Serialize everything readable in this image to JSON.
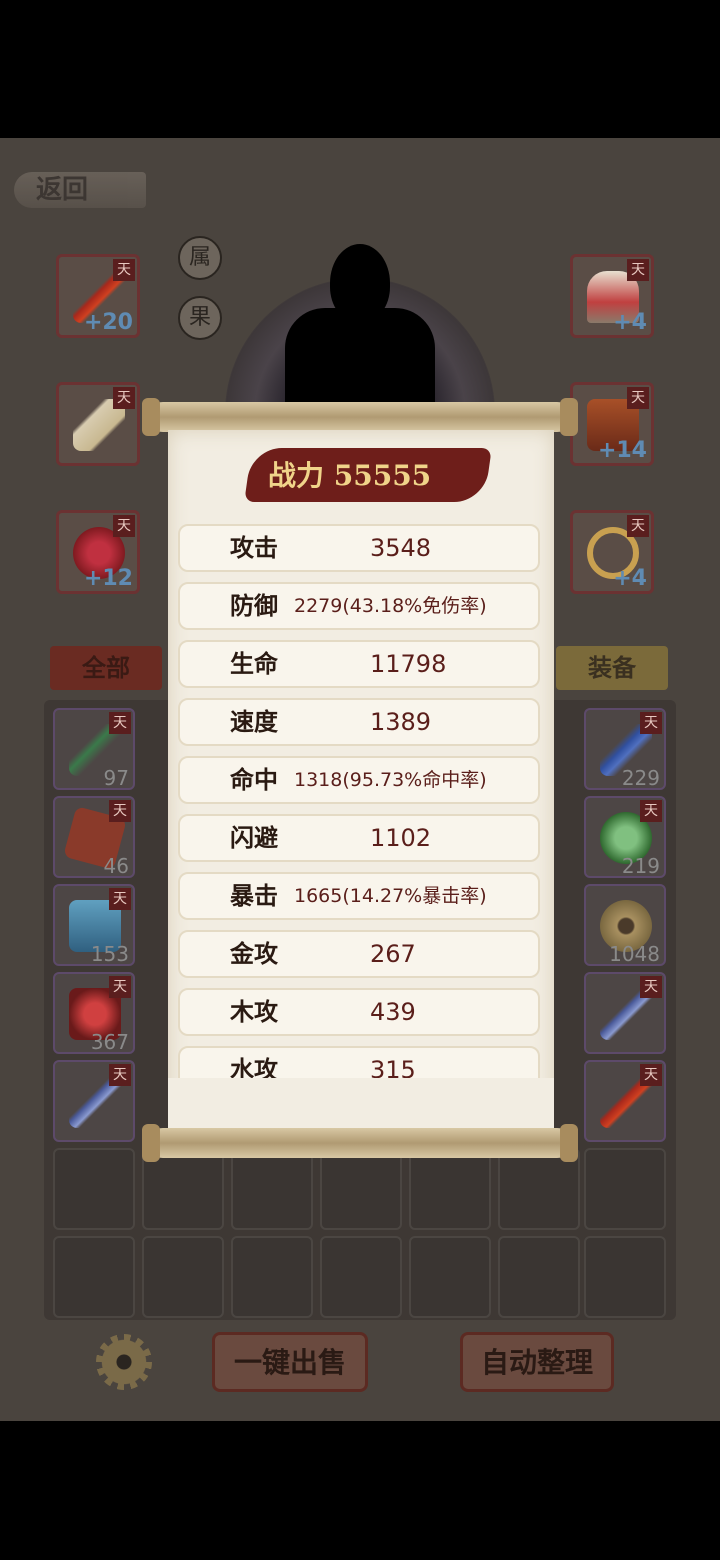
{
  "header": {
    "back_label": "返回"
  },
  "side_buttons": [
    "属",
    "果"
  ],
  "equip_left": [
    {
      "badge": "天",
      "level": "+20"
    },
    {
      "badge": "天",
      "level": ""
    },
    {
      "badge": "天",
      "level": "+12"
    }
  ],
  "equip_right": [
    {
      "badge": "天",
      "level": "+4"
    },
    {
      "badge": "天",
      "level": "+14"
    },
    {
      "badge": "天",
      "level": "+4"
    }
  ],
  "tabs": {
    "all": "全部",
    "equip": "装备"
  },
  "inventory": [
    {
      "badge": "天",
      "count": "97"
    },
    {
      "badge": "天",
      "count": "229"
    },
    {
      "badge": "天",
      "count": "46"
    },
    {
      "badge": "天",
      "count": "219"
    },
    {
      "badge": "天",
      "count": "153"
    },
    {
      "badge": "",
      "count": "1048"
    },
    {
      "badge": "天",
      "count": "367"
    },
    {
      "badge": "天",
      "count": ""
    },
    {
      "badge": "天",
      "count": ""
    },
    {
      "badge": "天",
      "count": ""
    }
  ],
  "bottom": {
    "sell_label": "一键出售",
    "sort_label": "自动整理"
  },
  "stats_panel": {
    "power": "战力 55555",
    "stats": [
      {
        "label": "攻击",
        "value": "3548"
      },
      {
        "label": "防御",
        "value": "2279(43.18%免伤率)"
      },
      {
        "label": "生命",
        "value": "11798"
      },
      {
        "label": "速度",
        "value": "1389"
      },
      {
        "label": "命中",
        "value": "1318(95.73%命中率)"
      },
      {
        "label": "闪避",
        "value": "1102"
      },
      {
        "label": "暴击",
        "value": "1665(14.27%暴击率)"
      },
      {
        "label": "金攻",
        "value": "267"
      },
      {
        "label": "木攻",
        "value": "439"
      },
      {
        "label": "水攻",
        "value": "315"
      }
    ]
  },
  "colors": {
    "banner": "#6e1e1a",
    "power_text": "#f0d48a",
    "value_text": "#5a1e1a"
  }
}
